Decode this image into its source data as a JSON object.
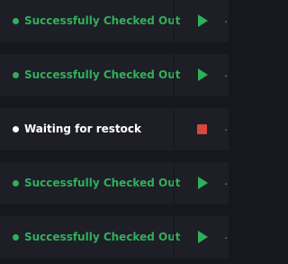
{
  "tasks": [
    {
      "status": "Successfully Checked Out",
      "status_color": "#2fb05a",
      "action": "play-icon"
    },
    {
      "status": "Successfully Checked Out",
      "status_color": "#2fb05a",
      "action": "play-icon"
    },
    {
      "status": "Waiting for restock",
      "status_color": "#ffffff",
      "action": "stop-icon"
    },
    {
      "status": "Successfully Checked Out",
      "status_color": "#2fb05a",
      "action": "play-icon"
    },
    {
      "status": "Successfully Checked Out",
      "status_color": "#2fb05a",
      "action": "play-icon"
    }
  ],
  "colors": {
    "background": "#17171f",
    "row": "#1e1e27",
    "success": "#2fb05a",
    "waiting": "#ffffff",
    "stop": "#d9473d"
  }
}
